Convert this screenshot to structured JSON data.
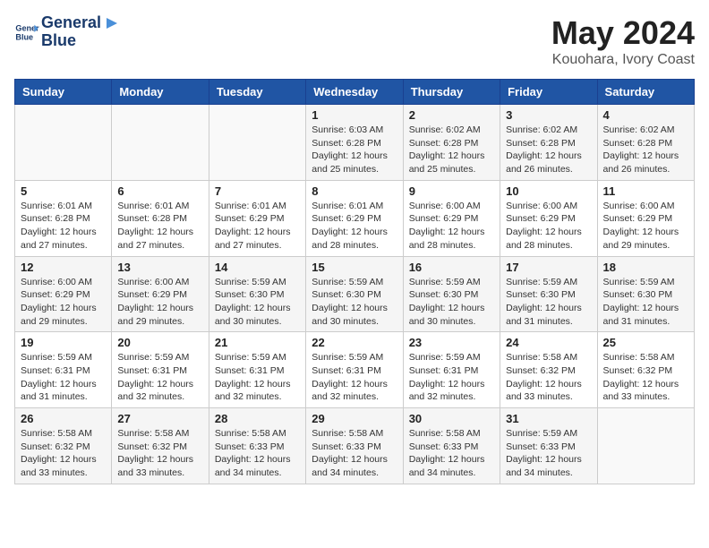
{
  "header": {
    "logo_line1": "General",
    "logo_line2": "Blue",
    "month": "May 2024",
    "location": "Kouohara, Ivory Coast"
  },
  "weekdays": [
    "Sunday",
    "Monday",
    "Tuesday",
    "Wednesday",
    "Thursday",
    "Friday",
    "Saturday"
  ],
  "weeks": [
    [
      {
        "day": "",
        "info": ""
      },
      {
        "day": "",
        "info": ""
      },
      {
        "day": "",
        "info": ""
      },
      {
        "day": "1",
        "info": "Sunrise: 6:03 AM\nSunset: 6:28 PM\nDaylight: 12 hours\nand 25 minutes."
      },
      {
        "day": "2",
        "info": "Sunrise: 6:02 AM\nSunset: 6:28 PM\nDaylight: 12 hours\nand 25 minutes."
      },
      {
        "day": "3",
        "info": "Sunrise: 6:02 AM\nSunset: 6:28 PM\nDaylight: 12 hours\nand 26 minutes."
      },
      {
        "day": "4",
        "info": "Sunrise: 6:02 AM\nSunset: 6:28 PM\nDaylight: 12 hours\nand 26 minutes."
      }
    ],
    [
      {
        "day": "5",
        "info": "Sunrise: 6:01 AM\nSunset: 6:28 PM\nDaylight: 12 hours\nand 27 minutes."
      },
      {
        "day": "6",
        "info": "Sunrise: 6:01 AM\nSunset: 6:28 PM\nDaylight: 12 hours\nand 27 minutes."
      },
      {
        "day": "7",
        "info": "Sunrise: 6:01 AM\nSunset: 6:29 PM\nDaylight: 12 hours\nand 27 minutes."
      },
      {
        "day": "8",
        "info": "Sunrise: 6:01 AM\nSunset: 6:29 PM\nDaylight: 12 hours\nand 28 minutes."
      },
      {
        "day": "9",
        "info": "Sunrise: 6:00 AM\nSunset: 6:29 PM\nDaylight: 12 hours\nand 28 minutes."
      },
      {
        "day": "10",
        "info": "Sunrise: 6:00 AM\nSunset: 6:29 PM\nDaylight: 12 hours\nand 28 minutes."
      },
      {
        "day": "11",
        "info": "Sunrise: 6:00 AM\nSunset: 6:29 PM\nDaylight: 12 hours\nand 29 minutes."
      }
    ],
    [
      {
        "day": "12",
        "info": "Sunrise: 6:00 AM\nSunset: 6:29 PM\nDaylight: 12 hours\nand 29 minutes."
      },
      {
        "day": "13",
        "info": "Sunrise: 6:00 AM\nSunset: 6:29 PM\nDaylight: 12 hours\nand 29 minutes."
      },
      {
        "day": "14",
        "info": "Sunrise: 5:59 AM\nSunset: 6:30 PM\nDaylight: 12 hours\nand 30 minutes."
      },
      {
        "day": "15",
        "info": "Sunrise: 5:59 AM\nSunset: 6:30 PM\nDaylight: 12 hours\nand 30 minutes."
      },
      {
        "day": "16",
        "info": "Sunrise: 5:59 AM\nSunset: 6:30 PM\nDaylight: 12 hours\nand 30 minutes."
      },
      {
        "day": "17",
        "info": "Sunrise: 5:59 AM\nSunset: 6:30 PM\nDaylight: 12 hours\nand 31 minutes."
      },
      {
        "day": "18",
        "info": "Sunrise: 5:59 AM\nSunset: 6:30 PM\nDaylight: 12 hours\nand 31 minutes."
      }
    ],
    [
      {
        "day": "19",
        "info": "Sunrise: 5:59 AM\nSunset: 6:31 PM\nDaylight: 12 hours\nand 31 minutes."
      },
      {
        "day": "20",
        "info": "Sunrise: 5:59 AM\nSunset: 6:31 PM\nDaylight: 12 hours\nand 32 minutes."
      },
      {
        "day": "21",
        "info": "Sunrise: 5:59 AM\nSunset: 6:31 PM\nDaylight: 12 hours\nand 32 minutes."
      },
      {
        "day": "22",
        "info": "Sunrise: 5:59 AM\nSunset: 6:31 PM\nDaylight: 12 hours\nand 32 minutes."
      },
      {
        "day": "23",
        "info": "Sunrise: 5:59 AM\nSunset: 6:31 PM\nDaylight: 12 hours\nand 32 minutes."
      },
      {
        "day": "24",
        "info": "Sunrise: 5:58 AM\nSunset: 6:32 PM\nDaylight: 12 hours\nand 33 minutes."
      },
      {
        "day": "25",
        "info": "Sunrise: 5:58 AM\nSunset: 6:32 PM\nDaylight: 12 hours\nand 33 minutes."
      }
    ],
    [
      {
        "day": "26",
        "info": "Sunrise: 5:58 AM\nSunset: 6:32 PM\nDaylight: 12 hours\nand 33 minutes."
      },
      {
        "day": "27",
        "info": "Sunrise: 5:58 AM\nSunset: 6:32 PM\nDaylight: 12 hours\nand 33 minutes."
      },
      {
        "day": "28",
        "info": "Sunrise: 5:58 AM\nSunset: 6:33 PM\nDaylight: 12 hours\nand 34 minutes."
      },
      {
        "day": "29",
        "info": "Sunrise: 5:58 AM\nSunset: 6:33 PM\nDaylight: 12 hours\nand 34 minutes."
      },
      {
        "day": "30",
        "info": "Sunrise: 5:58 AM\nSunset: 6:33 PM\nDaylight: 12 hours\nand 34 minutes."
      },
      {
        "day": "31",
        "info": "Sunrise: 5:59 AM\nSunset: 6:33 PM\nDaylight: 12 hours\nand 34 minutes."
      },
      {
        "day": "",
        "info": ""
      }
    ]
  ]
}
